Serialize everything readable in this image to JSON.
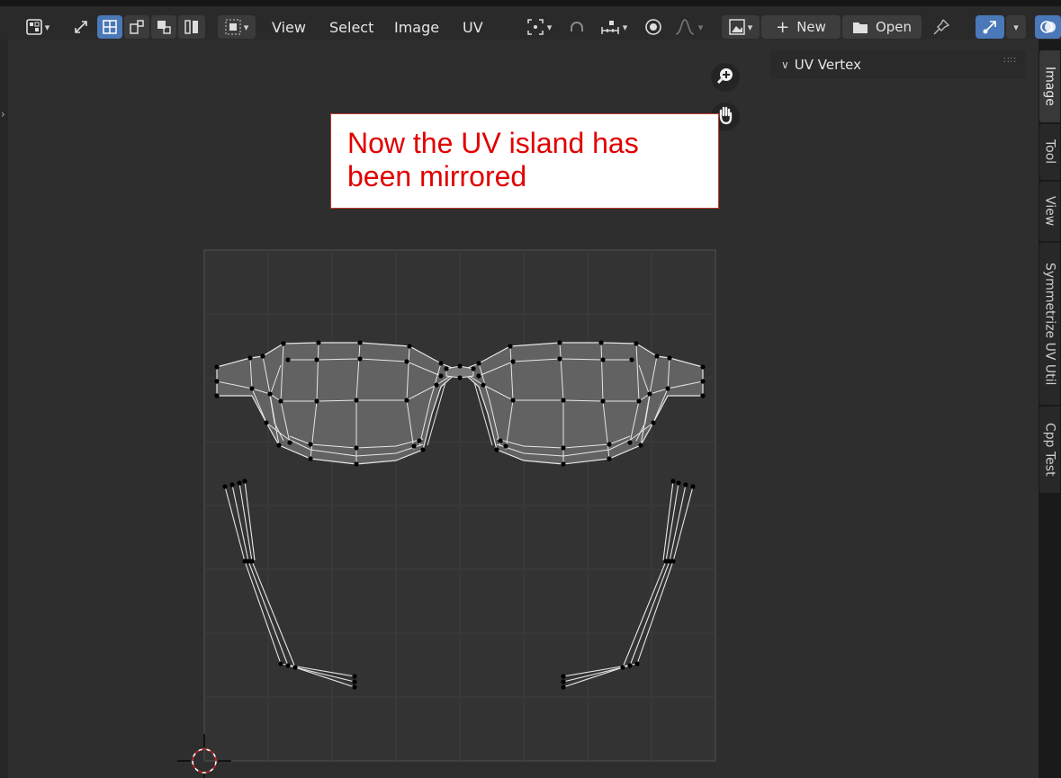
{
  "header": {
    "menus": [
      "View",
      "Select",
      "Image",
      "UV"
    ],
    "new_label": "New",
    "open_label": "Open"
  },
  "viewport": {
    "callout": [
      "Now the UV island has",
      "been mirrored"
    ],
    "panel_title": "UV Vertex"
  },
  "sidebar_tabs": [
    "Image",
    "Tool",
    "View",
    "Symmetrize UV Util",
    "Cpp Test"
  ],
  "colors": {
    "accent": "#4a78b8",
    "viewport": "#2e2e2e",
    "callout_text": "#e10000",
    "mesh_face": "#6a6a6a",
    "mesh_edge": "#e8e8e8",
    "vertex": "#000000"
  },
  "icons": {
    "editor_type": "image-editor-icon",
    "sync": "uv-sync-icon",
    "zoom": "zoom-in-icon",
    "pan": "hand-pan-icon",
    "cursor": "2d-cursor-icon",
    "pin": "pin-icon",
    "overlay": "overlay-icon",
    "gizmo": "gizmo-icon"
  }
}
